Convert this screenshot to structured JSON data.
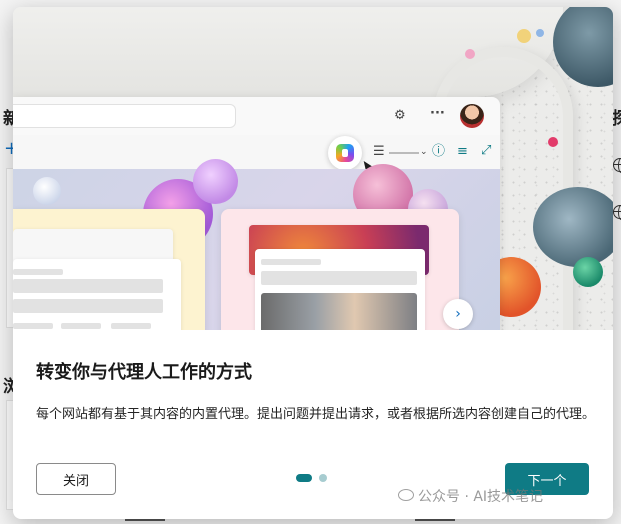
{
  "background": {
    "left_char_top": "新",
    "left_char_bottom": "浏",
    "left_plus": "+",
    "right_char": "探"
  },
  "dialog": {
    "title": "转变你与代理人工作的方式",
    "description": "每个网站都有基于其内容的内置代理。提出问题并提出请求，或者根据所选内容创建自己的代理。",
    "close_label": "关闭",
    "next_label": "下一个",
    "pager": {
      "current": 1,
      "total": 2
    }
  },
  "illustration": {
    "settings_icon": "gear-icon",
    "more_icon": "ellipsis-icon",
    "copilot_icon": "copilot-logo-icon",
    "info_icon": "info-icon",
    "filter_icon": "filter-icon",
    "expand_icon": "expand-icon",
    "next_icon": "chevron-right-icon"
  },
  "watermark": {
    "text": "公众号 · AI技术笔记"
  },
  "colors": {
    "accent": "#0f7b85",
    "accent_light": "#a7ccd0",
    "link_blue": "#0f6cbd"
  }
}
